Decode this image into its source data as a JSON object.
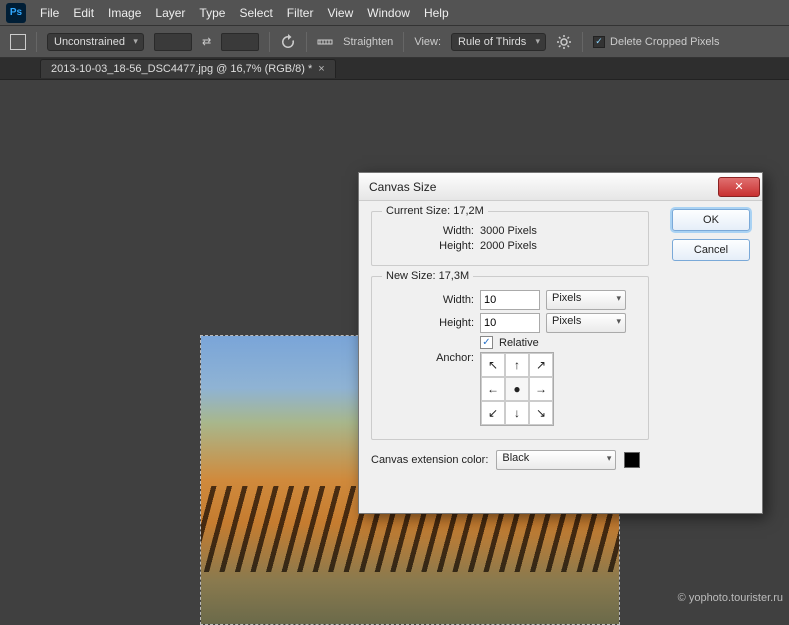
{
  "menu": {
    "items": [
      "File",
      "Edit",
      "Image",
      "Layer",
      "Type",
      "Select",
      "Filter",
      "View",
      "Window",
      "Help"
    ]
  },
  "optionsbar": {
    "ratio_mode": "Unconstrained",
    "straighten": "Straighten",
    "view_label": "View:",
    "view_mode": "Rule of Thirds",
    "delete_cropped_label": "Delete Cropped Pixels"
  },
  "tab": {
    "title": "2013-10-03_18-56_DSC4477.jpg @ 16,7% (RGB/8) *"
  },
  "dialog": {
    "title": "Canvas Size",
    "ok": "OK",
    "cancel": "Cancel",
    "current_legend": "Current Size: 17,2M",
    "current_width_label": "Width:",
    "current_width_value": "3000 Pixels",
    "current_height_label": "Height:",
    "current_height_value": "2000 Pixels",
    "new_legend": "New Size: 17,3M",
    "new_width_label": "Width:",
    "new_width_value": "10",
    "new_height_label": "Height:",
    "new_height_value": "10",
    "units": "Pixels",
    "relative_label": "Relative",
    "anchor_label": "Anchor:",
    "ext_label": "Canvas extension color:",
    "ext_value": "Black"
  },
  "watermark": "© yophoto.tourister.ru"
}
